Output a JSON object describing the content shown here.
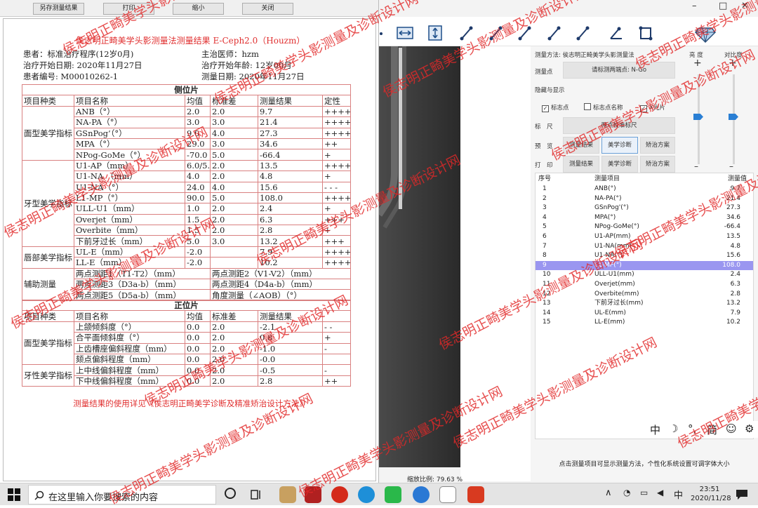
{
  "report_window": {
    "buttons": [
      "另存测量结果",
      "打印",
      "缩小",
      "关闭"
    ],
    "title": "侯志明正畸美学头影测量法测量结果 E-Ceph2.0（Houzm）",
    "patient_line": "患者：标准治疗程序(12岁0月)",
    "doctor_line": "主治医师：hzm",
    "start_date_line": "治疗开始日期: 2020年11月27日",
    "age_line": "治疗开始年龄: 12岁00月",
    "id_line": "患者编号: M00010262-1",
    "measure_date_line": "测量日期: 2020年11月27日",
    "lateral_title": "侧位片",
    "frontal_title": "正位片",
    "lateral_headers": [
      "项目种类",
      "项目名称",
      "均值",
      "标准差",
      "测量结果",
      "定性"
    ],
    "frontal_headers": [
      "项目种类",
      "项目名称",
      "均值",
      "标准差",
      "测量结果",
      ""
    ],
    "lateral_groups": [
      {
        "category": "面型美学指标",
        "rows": [
          {
            "name": "ANB（°）",
            "mean": "2.0",
            "sd": "2.0",
            "result": "9.7",
            "qual": "++++"
          },
          {
            "name": "NA-PA（°）",
            "mean": "3.0",
            "sd": "3.0",
            "result": "21.4",
            "qual": "++++"
          },
          {
            "name": "GSnPog’（°）",
            "mean": "9.0",
            "sd": "4.0",
            "result": "27.3",
            "qual": "++++"
          },
          {
            "name": "MPA（°）",
            "mean": "29.0",
            "sd": "3.0",
            "result": "34.6",
            "qual": "++"
          },
          {
            "name": "NPog-GoMe（°）",
            "mean": "-70.0",
            "sd": "5.0",
            "result": "-66.4",
            "qual": "+"
          }
        ]
      },
      {
        "category": "牙型美学指标",
        "rows": [
          {
            "name": "U1-AP（mm）",
            "mean": "6.0/5.0",
            "sd": "2.0",
            "result": "13.5",
            "qual": "++++"
          },
          {
            "name": "U1-NA （mm）",
            "mean": "4.0",
            "sd": "2.0",
            "result": "4.8",
            "qual": "+"
          },
          {
            "name": "U1-NA（°）",
            "mean": "24.0",
            "sd": "4.0",
            "result": "15.6",
            "qual": "- - -"
          },
          {
            "name": "L1-MP（°）",
            "mean": "90.0",
            "sd": "5.0",
            "result": "108.0",
            "qual": "++++"
          },
          {
            "name": "ULL-U1（mm）",
            "mean": "1.0",
            "sd": "2.0",
            "result": "2.4",
            "qual": "+"
          },
          {
            "name": "Overjet（mm）",
            "mean": "1.5",
            "sd": "2.0",
            "result": "6.3",
            "qual": "+++"
          },
          {
            "name": "Overbite（mm）",
            "mean": "1.5",
            "sd": "2.0",
            "result": "2.8",
            "qual": "+"
          },
          {
            "name": "下前牙过长（mm）",
            "mean": "5.0",
            "sd": "3.0",
            "result": "13.2",
            "qual": "+++"
          }
        ]
      },
      {
        "category": "唇部美学指标",
        "rows": [
          {
            "name": "UL-E（mm）",
            "mean": "-2.0",
            "sd": "",
            "result": "7.9",
            "qual": "++++"
          },
          {
            "name": "LL-E（mm）",
            "mean": "-2.0",
            "sd": "",
            "result": "10.2",
            "qual": "++++"
          }
        ]
      }
    ],
    "aux_category": "辅助测量",
    "aux_rows": [
      [
        "两点测距1（T1-T2）（mm）",
        "两点测距2（V1-V2）（mm）"
      ],
      [
        "两点测距3（D3a-b）（mm）",
        "两点测距4（D4a-b）（mm）"
      ],
      [
        "两点测距5（D5a-b）（mm）",
        "角度测量（∠AOB）（°）"
      ]
    ],
    "frontal_groups": [
      {
        "category": "面型美学指标",
        "rows": [
          {
            "name": "上颌倾斜度（°）",
            "mean": "0.0",
            "sd": "2.0",
            "result": "-2.1",
            "qual": "- -"
          },
          {
            "name": "合平面倾斜度（°）",
            "mean": "0.0",
            "sd": "2.0",
            "result": "0.8",
            "qual": "+"
          },
          {
            "name": "上齿槽座偏斜程度（mm）",
            "mean": "0.0",
            "sd": "2.0",
            "result": "-1.0",
            "qual": "-"
          },
          {
            "name": "颏点偏斜程度（mm）",
            "mean": "0.0",
            "sd": "2.0",
            "result": "-0.0",
            "qual": ""
          }
        ]
      },
      {
        "category": "牙性美学指标",
        "rows": [
          {
            "name": "上中线偏斜程度（mm）",
            "mean": "0.0",
            "sd": "2.0",
            "result": "-0.5",
            "qual": "-"
          },
          {
            "name": "下中线偏斜程度（mm）",
            "mean": "0.0",
            "sd": "2.0",
            "result": "2.8",
            "qual": "++"
          }
        ]
      }
    ],
    "footnote": "测量结果的使用详见《侯志明正畸美学诊断及精准矫治设计方法》"
  },
  "app": {
    "window_controls": [
      "–",
      "□",
      "✕"
    ],
    "method_label": "测量方法: 侯志明正畸美学头影测量法",
    "point_label": "测量点",
    "point_value": "请标测两端点: N-Go",
    "hide_show_label": "隐藏与显示",
    "checks": [
      {
        "label": "标志点",
        "checked": true
      },
      {
        "label": "标志点名称",
        "checked": false
      },
      {
        "label": "X光片",
        "checked": true
      }
    ],
    "ruler_label": "标　尺",
    "ruler_button": "两点校准标尺",
    "preview_label": "预　览",
    "print_label": "打　印",
    "btn_result": "测量结果",
    "btn_aesthetic": "美学诊断",
    "btn_plan": "矫治方案",
    "brightness_label": "亮 度",
    "contrast_label": "对比度",
    "slider_plus": "+",
    "slider_minus": "–",
    "list_headers": [
      "序号",
      "测量项目",
      "测量值"
    ],
    "list_rows": [
      [
        "1",
        "ANB(°)",
        "9.7"
      ],
      [
        "2",
        "NA-PA(°)",
        "21.4"
      ],
      [
        "3",
        "GSnPog'(°)",
        "27.3"
      ],
      [
        "4",
        "MPA(°)",
        "34.6"
      ],
      [
        "5",
        "NPog-GoMe(°)",
        "-66.4"
      ],
      [
        "6",
        "U1-AP(mm)",
        "13.5"
      ],
      [
        "7",
        "U1-NA(mm)",
        "4.8"
      ],
      [
        "8",
        "U1-NA(°)",
        "15.6"
      ],
      [
        "9",
        "L1-MP(°)",
        "108.0"
      ],
      [
        "10",
        "ULL-U1(mm)",
        "2.4"
      ],
      [
        "11",
        "Overjet(mm)",
        "6.3"
      ],
      [
        "12",
        "Overbite(mm)",
        "2.8"
      ],
      [
        "13",
        "下前牙过长(mm)",
        "13.2"
      ],
      [
        "14",
        "UL-E(mm)",
        "7.9"
      ],
      [
        "15",
        "LL-E(mm)",
        "10.2"
      ]
    ],
    "selected_row": 9,
    "ime": [
      "中",
      "☽",
      "°,",
      "简",
      "☺",
      "⚙"
    ],
    "status": "点击测量项目可显示测量方法，个性化系统设置可调字体大小",
    "zoom": "缩放比例: 79.63 %"
  },
  "taskbar": {
    "search_placeholder": "在这里输入你要搜索的内容",
    "tray_lang": "中",
    "time": "23:51",
    "date": "2020/11/28"
  },
  "watermark": "侯志明正畸美学头影测量及诊断设计网",
  "colors": {
    "accent_red": "#e62020",
    "selected_row": "#9a96f0",
    "taskbar": "#e4e4e4"
  }
}
